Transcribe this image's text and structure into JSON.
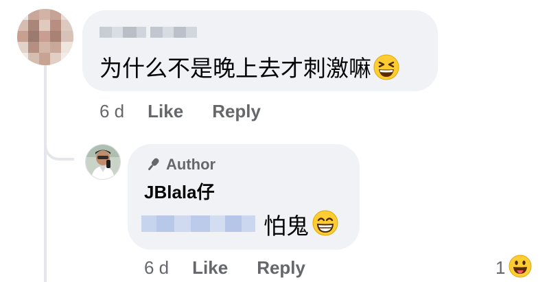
{
  "comment": {
    "text": "为什么不是晚上去才刺激嘛",
    "emoji": "grinning-squinting-face",
    "time": "6 d",
    "like_label": "Like",
    "reply_label": "Reply"
  },
  "reply": {
    "badge": "Author",
    "author_name": "JBlala仔",
    "text": "怕鬼",
    "emoji": "beaming-face-with-smiling-eyes",
    "time": "6 d",
    "like_label": "Like",
    "reply_label": "Reply",
    "reaction_count": "1",
    "reaction_emoji": "face-with-tongue"
  },
  "colors": {
    "bubble": "#f0f2f5",
    "meta_text": "#65676b",
    "emoji_yellow": "#ffcc33"
  }
}
